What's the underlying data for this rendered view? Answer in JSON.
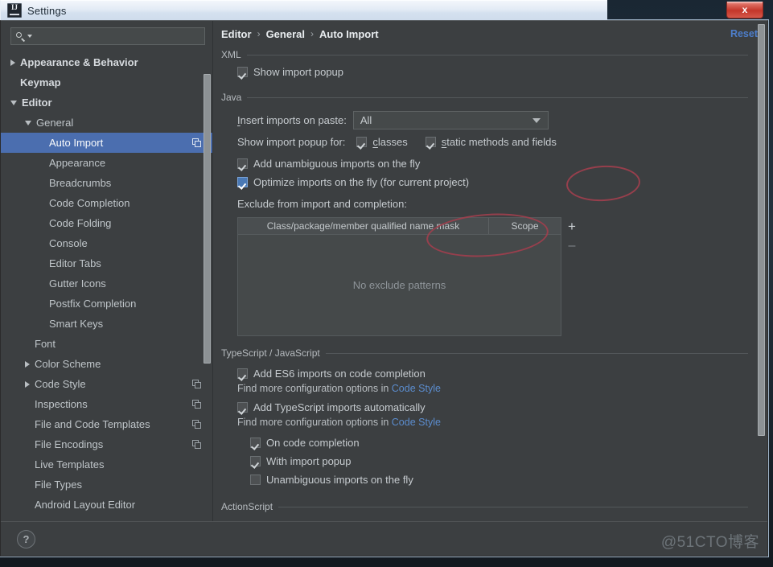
{
  "window": {
    "title": "Settings",
    "app_icon": "intellij-idea-icon",
    "close_label": "x"
  },
  "search": {
    "placeholder": "",
    "value": "",
    "icon": "search-icon"
  },
  "sidebar": {
    "items": [
      {
        "label": "Appearance & Behavior",
        "indent": 0,
        "twisty": "collapsed",
        "bold": true,
        "selected": false,
        "copy": false
      },
      {
        "label": "Keymap",
        "indent": 0,
        "twisty": "none",
        "bold": true,
        "selected": false,
        "copy": false
      },
      {
        "label": "Editor",
        "indent": 0,
        "twisty": "expanded",
        "bold": true,
        "selected": false,
        "copy": false
      },
      {
        "label": "General",
        "indent": 1,
        "twisty": "expanded",
        "bold": false,
        "selected": false,
        "copy": false
      },
      {
        "label": "Auto Import",
        "indent": 2,
        "twisty": "none",
        "bold": false,
        "selected": true,
        "copy": true
      },
      {
        "label": "Appearance",
        "indent": 2,
        "twisty": "none",
        "bold": false,
        "selected": false,
        "copy": false
      },
      {
        "label": "Breadcrumbs",
        "indent": 2,
        "twisty": "none",
        "bold": false,
        "selected": false,
        "copy": false
      },
      {
        "label": "Code Completion",
        "indent": 2,
        "twisty": "none",
        "bold": false,
        "selected": false,
        "copy": false
      },
      {
        "label": "Code Folding",
        "indent": 2,
        "twisty": "none",
        "bold": false,
        "selected": false,
        "copy": false
      },
      {
        "label": "Console",
        "indent": 2,
        "twisty": "none",
        "bold": false,
        "selected": false,
        "copy": false
      },
      {
        "label": "Editor Tabs",
        "indent": 2,
        "twisty": "none",
        "bold": false,
        "selected": false,
        "copy": false
      },
      {
        "label": "Gutter Icons",
        "indent": 2,
        "twisty": "none",
        "bold": false,
        "selected": false,
        "copy": false
      },
      {
        "label": "Postfix Completion",
        "indent": 2,
        "twisty": "none",
        "bold": false,
        "selected": false,
        "copy": false
      },
      {
        "label": "Smart Keys",
        "indent": 2,
        "twisty": "none",
        "bold": false,
        "selected": false,
        "copy": false
      },
      {
        "label": "Font",
        "indent": 1,
        "twisty": "none",
        "bold": false,
        "selected": false,
        "copy": false
      },
      {
        "label": "Color Scheme",
        "indent": 1,
        "twisty": "collapsed",
        "bold": false,
        "selected": false,
        "copy": false
      },
      {
        "label": "Code Style",
        "indent": 1,
        "twisty": "collapsed",
        "bold": false,
        "selected": false,
        "copy": true
      },
      {
        "label": "Inspections",
        "indent": 1,
        "twisty": "none",
        "bold": false,
        "selected": false,
        "copy": true
      },
      {
        "label": "File and Code Templates",
        "indent": 1,
        "twisty": "none",
        "bold": false,
        "selected": false,
        "copy": true
      },
      {
        "label": "File Encodings",
        "indent": 1,
        "twisty": "none",
        "bold": false,
        "selected": false,
        "copy": true
      },
      {
        "label": "Live Templates",
        "indent": 1,
        "twisty": "none",
        "bold": false,
        "selected": false,
        "copy": false
      },
      {
        "label": "File Types",
        "indent": 1,
        "twisty": "none",
        "bold": false,
        "selected": false,
        "copy": false
      },
      {
        "label": "Android Layout Editor",
        "indent": 1,
        "twisty": "none",
        "bold": false,
        "selected": false,
        "copy": false
      }
    ]
  },
  "breadcrumb": {
    "items": [
      "Editor",
      "General",
      "Auto Import"
    ],
    "separator": "›",
    "reset_label": "Reset"
  },
  "sections": {
    "xml": {
      "title": "XML",
      "show_import_popup": {
        "label": "Show import popup",
        "checked": true
      }
    },
    "java": {
      "title": "Java",
      "insert_imports_label": "Insert imports on paste:",
      "insert_imports_mnemonic": "I",
      "insert_imports_value": "All",
      "show_popup_for_label": "Show import popup for:",
      "classes": {
        "label": "classes",
        "mnemonic": "c",
        "checked": true
      },
      "static_methods": {
        "label": "static methods and fields",
        "mnemonic": "s",
        "checked": true
      },
      "add_unambiguous": {
        "label": "Add unambiguous imports on the fly",
        "checked": true
      },
      "optimize_imports": {
        "label": "Optimize imports on the fly (for current project)",
        "checked": true,
        "focused": true
      },
      "exclude_label": "Exclude from import and completion:",
      "table": {
        "columns": [
          "Class/package/member qualified name mask",
          "Scope"
        ],
        "rows": [],
        "empty_text": "No exclude patterns",
        "add_label": "+",
        "remove_label": "–"
      }
    },
    "typescript": {
      "title": "TypeScript / JavaScript",
      "es6": {
        "label": "Add ES6 imports on code completion",
        "checked": true
      },
      "hint1_prefix": "Find more configuration options in ",
      "hint1_link": "Code Style",
      "ts_auto": {
        "label": "Add TypeScript imports automatically",
        "checked": true
      },
      "hint2_prefix": "Find more configuration options in ",
      "hint2_link": "Code Style",
      "on_completion": {
        "label": "On code completion",
        "checked": true
      },
      "with_popup": {
        "label": "With import popup",
        "checked": true
      },
      "unambiguous": {
        "label": "Unambiguous imports on the fly",
        "checked": false
      }
    },
    "actionscript": {
      "title": "ActionScript"
    }
  },
  "footer": {
    "help_label": "?",
    "watermark": "@51CTO博客"
  },
  "colors": {
    "selection": "#4b6eaf",
    "link": "#5b8ccd",
    "annotation": "#9e3f4d",
    "panel_bg": "#3c3f41"
  }
}
